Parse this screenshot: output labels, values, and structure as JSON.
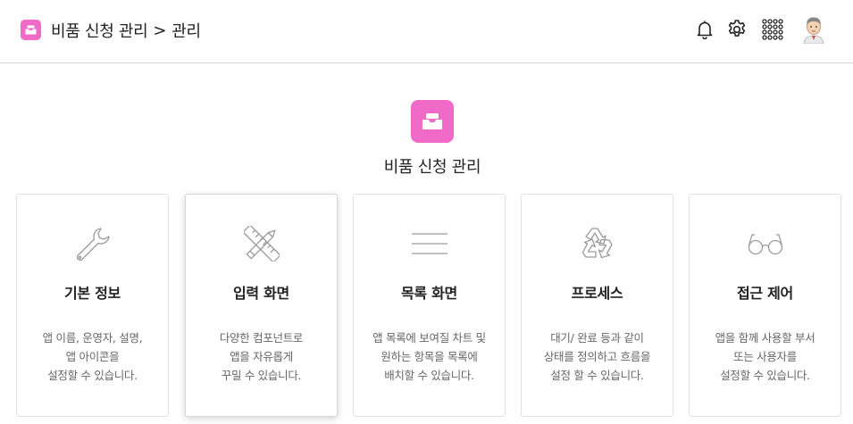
{
  "header": {
    "app_name": "비품 신청 관리",
    "separator": ">",
    "current_page": "관리",
    "app_color": "#f06ac8"
  },
  "top_icons": [
    "bell-icon",
    "gear-icon",
    "apps-grid-icon",
    "user-avatar"
  ],
  "hero": {
    "title": "비품 신청 관리",
    "icon": "inbox-tray-icon"
  },
  "cards": [
    {
      "icon": "wrench-icon",
      "title": "기본 정보",
      "desc": [
        "앱 이름, 운영자, 설명,",
        "앱 아이콘을",
        "설정할 수 있습니다."
      ],
      "active": false
    },
    {
      "icon": "ruler-pencil-icon",
      "title": "입력 화면",
      "desc": [
        "다양한 컴포넌트로",
        "앱을 자유롭게",
        "꾸밀 수 있습니다."
      ],
      "active": true
    },
    {
      "icon": "list-lines-icon",
      "title": "목록 화면",
      "desc": [
        "앱 목록에 보여질 차트 및",
        "원하는 항목을 목록에",
        "배치할 수 있습니다."
      ],
      "active": false
    },
    {
      "icon": "recycle-icon",
      "title": "프로세스",
      "desc": [
        "대기/ 완료 등과 같이",
        "상태를 정의하고 흐름을",
        "설정 할 수 있습니다."
      ],
      "active": false
    },
    {
      "icon": "glasses-icon",
      "title": "접근 제어",
      "desc": [
        "앱을 함께 사용할 부서",
        "또는 사용자를",
        "설정할 수 있습니다."
      ],
      "active": false
    }
  ]
}
